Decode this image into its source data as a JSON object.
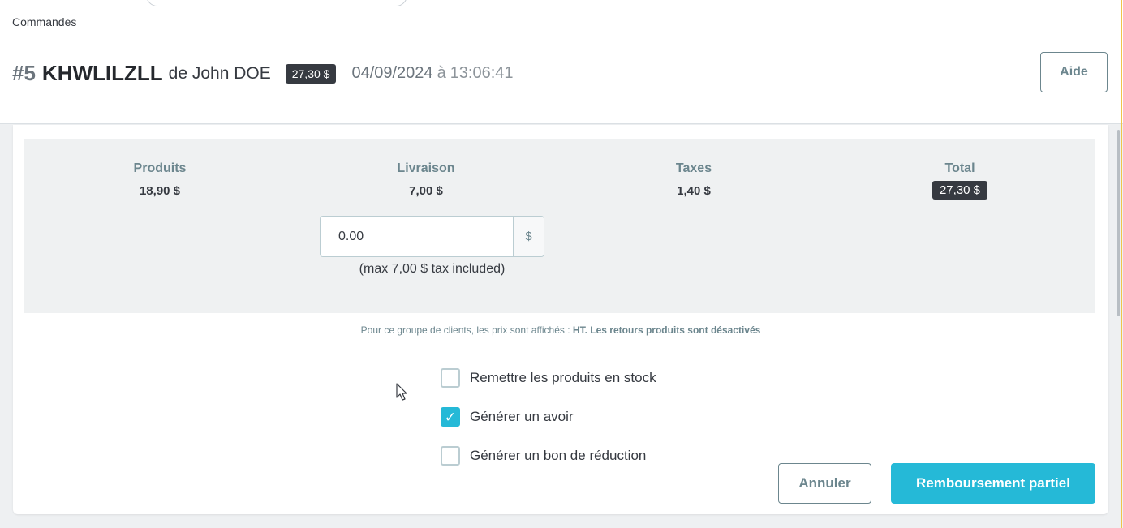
{
  "breadcrumb": {
    "label": "Commandes"
  },
  "order": {
    "number": "#5",
    "reference": "KHWLILZLL",
    "customer_text": "de John DOE",
    "total_badge": "27,30 $",
    "date": "04/09/2024",
    "at_word": "à",
    "time": "13:06:41"
  },
  "header": {
    "help_label": "Aide"
  },
  "summary": {
    "products": {
      "label": "Produits",
      "value": "18,90 $"
    },
    "shipping": {
      "label": "Livraison",
      "value": "7,00 $"
    },
    "taxes": {
      "label": "Taxes",
      "value": "1,40 $"
    },
    "total": {
      "label": "Total",
      "value": "27,30 $"
    }
  },
  "shipping_refund": {
    "value": "0.00",
    "currency": "$",
    "hint": "(max 7,00 $ tax included)"
  },
  "price_note": {
    "prefix": "Pour ce groupe de clients, les prix sont affichés : ",
    "tax_mode": "HT.",
    "returns_text": "Les retours produits sont désactivés"
  },
  "options": [
    {
      "label": "Remettre les produits en stock",
      "checked": false
    },
    {
      "label": "Générer un avoir",
      "checked": true
    },
    {
      "label": "Générer un bon de réduction",
      "checked": false
    }
  ],
  "actions": {
    "cancel_label": "Annuler",
    "refund_label": "Remboursement partiel"
  },
  "colors": {
    "primary": "#25b9d7",
    "badge": "#363a41",
    "muted": "#6c868e"
  }
}
